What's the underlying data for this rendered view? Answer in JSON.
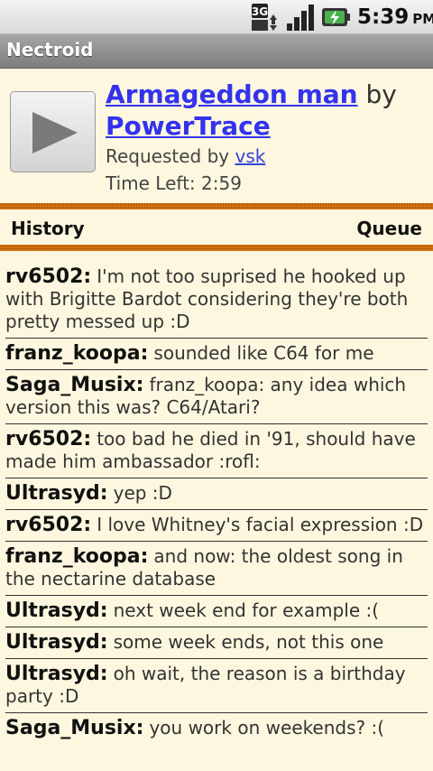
{
  "status_bar": {
    "network_icon": "3g-icon",
    "signal_icon": "signal-icon",
    "battery_icon": "battery-charging-icon",
    "time": "5:39",
    "ampm": "PM"
  },
  "app": {
    "title": "Nectroid"
  },
  "now_playing": {
    "play_icon": "play-icon",
    "song_title": "Armageddon man",
    "by_text": "by",
    "artist": "PowerTrace",
    "requested_prefix": "Requested by",
    "requester": "vsk",
    "time_left": "Time Left: 2:59"
  },
  "tabs": [
    {
      "label": "History"
    },
    {
      "label": "Queue"
    }
  ],
  "colors": {
    "accent_band": "#e07c12",
    "background": "#fdf7df",
    "link": "#3333ee"
  },
  "chat": [
    {
      "user": "rv6502:",
      "text": "I'm not too suprised he hooked up with Brigitte Bardot considering they're both pretty messed up :D"
    },
    {
      "user": "franz_koopa:",
      "text": "sounded like C64 for me"
    },
    {
      "user": "Saga_Musix:",
      "text": "franz_koopa: any idea which version this was? C64/Atari?"
    },
    {
      "user": "rv6502:",
      "text": "too bad he died in '91, should have made him ambassador :rofl:"
    },
    {
      "user": "Ultrasyd:",
      "text": "yep :D"
    },
    {
      "user": "rv6502:",
      "text": "I love Whitney's facial expression :D"
    },
    {
      "user": "franz_koopa:",
      "text": "and now: the oldest song in the nectarine database"
    },
    {
      "user": "Ultrasyd:",
      "text": "next week end for example :("
    },
    {
      "user": "Ultrasyd:",
      "text": "some week ends, not this one"
    },
    {
      "user": "Ultrasyd:",
      "text": "oh wait, the reason is a birthday party :D"
    },
    {
      "user": "Saga_Musix:",
      "text": "you work on weekends? :("
    }
  ]
}
